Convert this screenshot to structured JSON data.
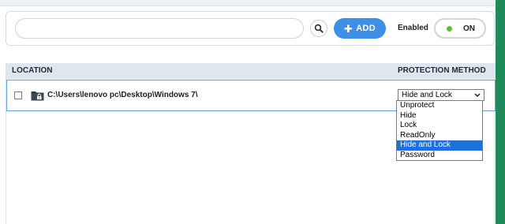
{
  "search": {
    "placeholder": "",
    "value": ""
  },
  "toolbar": {
    "add_label": "ADD",
    "add_icon": "plus-icon",
    "enabled_label": "Enabled",
    "toggle_state": "ON"
  },
  "table": {
    "columns": [
      "LOCATION",
      "PROTECTION METHOD"
    ],
    "rows": [
      {
        "path": "C:\\Users\\lenovo pc\\Desktop\\Windows 7\\",
        "method": "Hide and Lock",
        "icon": "locked-folder-icon"
      }
    ]
  },
  "method_options": [
    "Unprotect",
    "Hide",
    "Lock",
    "ReadOnly",
    "Hide and Lock",
    "Password"
  ],
  "selected_option_index": 4,
  "colors": {
    "accent": "#3d8fe8",
    "toggle_dot": "#5cc22a",
    "selection": "#1e6fe0",
    "row_border": "#5fa3e6",
    "header_bg": "#dfe6ee",
    "desktop_edge": "#1f8a5a"
  }
}
